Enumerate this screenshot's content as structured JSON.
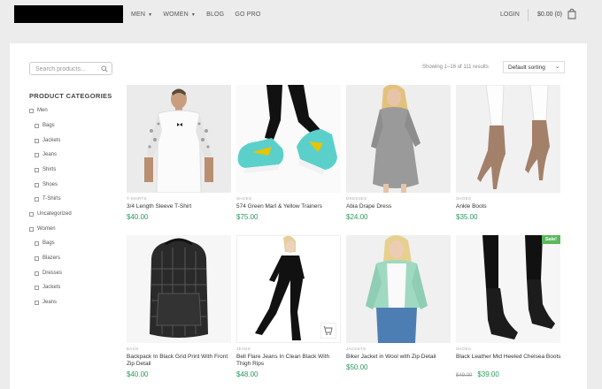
{
  "header": {
    "nav": [
      {
        "label": "MEN",
        "dropdown": true
      },
      {
        "label": "WOMEN",
        "dropdown": true
      },
      {
        "label": "BLOG",
        "dropdown": false
      },
      {
        "label": "GO PRO",
        "dropdown": false
      }
    ],
    "login": "LOGIN",
    "cart": "$0.00 (0)",
    "icons": [
      "bag-icon",
      "chevron-down-icon"
    ]
  },
  "search": {
    "placeholder": "Search products..."
  },
  "categories": {
    "title": "PRODUCT CATEGORIES",
    "items": [
      {
        "label": "Men",
        "level": 0
      },
      {
        "label": "Bags",
        "level": 1
      },
      {
        "label": "Jackets",
        "level": 1
      },
      {
        "label": "Jeans",
        "level": 1
      },
      {
        "label": "Shirts",
        "level": 1
      },
      {
        "label": "Shoes",
        "level": 1
      },
      {
        "label": "T-Shirts",
        "level": 1
      },
      {
        "label": "Uncategorized",
        "level": 0
      },
      {
        "label": "Women",
        "level": 0
      },
      {
        "label": "Bags",
        "level": 1
      },
      {
        "label": "Blazers",
        "level": 1
      },
      {
        "label": "Dresses",
        "level": 1
      },
      {
        "label": "Jackets",
        "level": 1
      },
      {
        "label": "Jeans",
        "level": 1
      }
    ]
  },
  "shop": {
    "results": "Showing 1–16 of 111 results",
    "sort": "Default sorting"
  },
  "products": [
    {
      "category": "T-SHIRTS",
      "name": "3/4 Length Sleeve T-Shirt",
      "price": "$40.00"
    },
    {
      "category": "SHOES",
      "name": "574 Green Marl & Yellow Trainers",
      "price": "$75.00"
    },
    {
      "category": "DRESSES",
      "name": "Abia Drape Dress",
      "price": "$24.00"
    },
    {
      "category": "SHOES",
      "name": "Ankle Boots",
      "price": "$35.00"
    },
    {
      "category": "BAGS",
      "name": "Backpack In Black Grid Print With Front Zip Detail",
      "price": "$40.00"
    },
    {
      "category": "JEANS",
      "name": "Bell Flare Jeans In Clean Black With Thigh Rips",
      "price": "$48.00"
    },
    {
      "category": "JACKETS",
      "name": "Biker Jacket in Wool with Zip Detail",
      "price": "$50.00"
    },
    {
      "category": "SHOES",
      "name": "Black Leather Mid Heeled Chelsea Boots",
      "price": "$39.00",
      "old_price": "$49.00",
      "badge": "Sale!"
    }
  ],
  "colors": {
    "price": "#2a9a5c",
    "sale_badge": "#5bb85d",
    "page_bg": "#ececec"
  }
}
